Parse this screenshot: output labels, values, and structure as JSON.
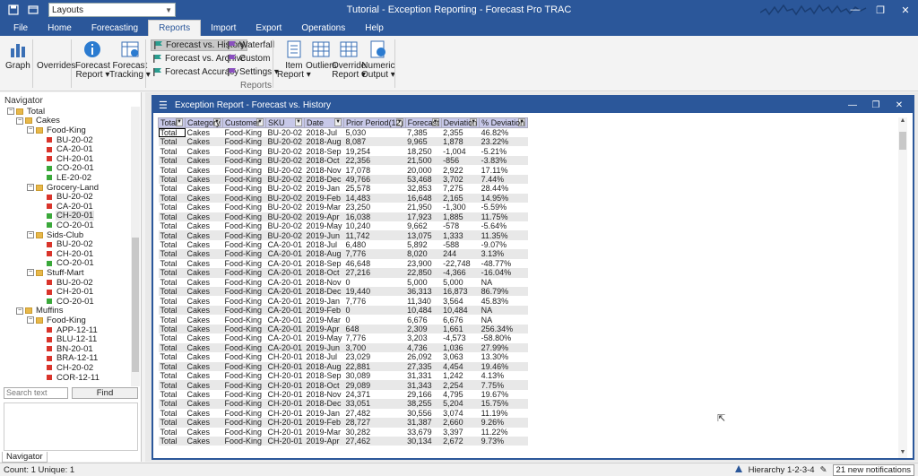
{
  "app": {
    "title": "Tutorial - Exception Reporting - Forecast Pro TRAC",
    "layout_combo": "Layouts"
  },
  "ribbon": {
    "tabs": [
      "File",
      "Home",
      "Forecasting",
      "Reports",
      "Import",
      "Export",
      "Operations",
      "Help"
    ],
    "active_tab": "Reports",
    "buttons": {
      "graph": "Graph",
      "overrides": "Overrides",
      "forecast_report_1": "Forecast",
      "forecast_report_2": "Report",
      "forecast_tracking_1": "Forecast",
      "forecast_tracking_2": "Tracking",
      "item_report_1": "Item",
      "item_report_2": "Report",
      "outliers": "Outliers",
      "override_report_1": "Override",
      "override_report_2": "Report",
      "numeric_output_1": "Numeric",
      "numeric_output_2": "Output"
    },
    "small": {
      "fvh": "Forecast vs. History",
      "fva": "Forecast vs. Archive",
      "fa": "Forecast Accuracy",
      "waterfall": "Waterfall",
      "custom": "Custom",
      "settings": "Settings"
    },
    "group_label": "Reports"
  },
  "navigator": {
    "title": "Navigator",
    "search_placeholder": "Search text",
    "find_label": "Find",
    "tab_label": "Navigator",
    "tree": [
      {
        "label": "Total",
        "level": 0,
        "kind": "folder"
      },
      {
        "label": "Cakes",
        "level": 1,
        "kind": "folder"
      },
      {
        "label": "Food-King",
        "level": 2,
        "kind": "folder"
      },
      {
        "label": "BU-20-02",
        "level": 3,
        "kind": "red"
      },
      {
        "label": "CA-20-01",
        "level": 3,
        "kind": "red"
      },
      {
        "label": "CH-20-01",
        "level": 3,
        "kind": "red"
      },
      {
        "label": "CO-20-01",
        "level": 3,
        "kind": "green"
      },
      {
        "label": "LE-20-02",
        "level": 3,
        "kind": "green"
      },
      {
        "label": "Grocery-Land",
        "level": 2,
        "kind": "folder"
      },
      {
        "label": "BU-20-02",
        "level": 3,
        "kind": "red"
      },
      {
        "label": "CA-20-01",
        "level": 3,
        "kind": "red"
      },
      {
        "label": "CH-20-01",
        "level": 3,
        "kind": "green",
        "highlight": true
      },
      {
        "label": "CO-20-01",
        "level": 3,
        "kind": "green"
      },
      {
        "label": "Sids-Club",
        "level": 2,
        "kind": "folder"
      },
      {
        "label": "BU-20-02",
        "level": 3,
        "kind": "red"
      },
      {
        "label": "CH-20-01",
        "level": 3,
        "kind": "red"
      },
      {
        "label": "CO-20-01",
        "level": 3,
        "kind": "green"
      },
      {
        "label": "Stuff-Mart",
        "level": 2,
        "kind": "folder"
      },
      {
        "label": "BU-20-02",
        "level": 3,
        "kind": "red"
      },
      {
        "label": "CH-20-01",
        "level": 3,
        "kind": "red"
      },
      {
        "label": "CO-20-01",
        "level": 3,
        "kind": "green"
      },
      {
        "label": "Muffins",
        "level": 1,
        "kind": "folder"
      },
      {
        "label": "Food-King",
        "level": 2,
        "kind": "folder"
      },
      {
        "label": "APP-12-11",
        "level": 3,
        "kind": "red"
      },
      {
        "label": "BLU-12-11",
        "level": 3,
        "kind": "red"
      },
      {
        "label": "BN-20-01",
        "level": 3,
        "kind": "red"
      },
      {
        "label": "BRA-12-11",
        "level": 3,
        "kind": "red"
      },
      {
        "label": "CH-20-02",
        "level": 3,
        "kind": "red"
      },
      {
        "label": "COR-12-11",
        "level": 3,
        "kind": "red"
      }
    ]
  },
  "report": {
    "window_title": "Exception Report - Forecast vs. History",
    "columns": [
      "Total",
      "Category",
      "Customer",
      "SKU",
      "Date",
      "Prior Period(12)",
      "Forecast",
      "Deviation",
      "% Deviation"
    ],
    "rows": [
      [
        "Total",
        "Cakes",
        "Food-King",
        "BU-20-02",
        "2018-Jul",
        "5,030",
        "7,385",
        "2,355",
        "46.82%"
      ],
      [
        "Total",
        "Cakes",
        "Food-King",
        "BU-20-02",
        "2018-Aug",
        "8,087",
        "9,965",
        "1,878",
        "23.22%"
      ],
      [
        "Total",
        "Cakes",
        "Food-King",
        "BU-20-02",
        "2018-Sep",
        "19,254",
        "18,250",
        "-1,004",
        "-5.21%"
      ],
      [
        "Total",
        "Cakes",
        "Food-King",
        "BU-20-02",
        "2018-Oct",
        "22,356",
        "21,500",
        "-856",
        "-3.83%"
      ],
      [
        "Total",
        "Cakes",
        "Food-King",
        "BU-20-02",
        "2018-Nov",
        "17,078",
        "20,000",
        "2,922",
        "17.11%"
      ],
      [
        "Total",
        "Cakes",
        "Food-King",
        "BU-20-02",
        "2018-Dec",
        "49,766",
        "53,468",
        "3,702",
        "7.44%"
      ],
      [
        "Total",
        "Cakes",
        "Food-King",
        "BU-20-02",
        "2019-Jan",
        "25,578",
        "32,853",
        "7,275",
        "28.44%"
      ],
      [
        "Total",
        "Cakes",
        "Food-King",
        "BU-20-02",
        "2019-Feb",
        "14,483",
        "16,648",
        "2,165",
        "14.95%"
      ],
      [
        "Total",
        "Cakes",
        "Food-King",
        "BU-20-02",
        "2019-Mar",
        "23,250",
        "21,950",
        "-1,300",
        "-5.59%"
      ],
      [
        "Total",
        "Cakes",
        "Food-King",
        "BU-20-02",
        "2019-Apr",
        "16,038",
        "17,923",
        "1,885",
        "11.75%"
      ],
      [
        "Total",
        "Cakes",
        "Food-King",
        "BU-20-02",
        "2019-May",
        "10,240",
        "9,662",
        "-578",
        "-5.64%"
      ],
      [
        "Total",
        "Cakes",
        "Food-King",
        "BU-20-02",
        "2019-Jun",
        "11,742",
        "13,075",
        "1,333",
        "11.35%"
      ],
      [
        "Total",
        "Cakes",
        "Food-King",
        "CA-20-01",
        "2018-Jul",
        "6,480",
        "5,892",
        "-588",
        "-9.07%"
      ],
      [
        "Total",
        "Cakes",
        "Food-King",
        "CA-20-01",
        "2018-Aug",
        "7,776",
        "8,020",
        "244",
        "3.13%"
      ],
      [
        "Total",
        "Cakes",
        "Food-King",
        "CA-20-01",
        "2018-Sep",
        "46,648",
        "23,900",
        "-22,748",
        "-48.77%"
      ],
      [
        "Total",
        "Cakes",
        "Food-King",
        "CA-20-01",
        "2018-Oct",
        "27,216",
        "22,850",
        "-4,366",
        "-16.04%"
      ],
      [
        "Total",
        "Cakes",
        "Food-King",
        "CA-20-01",
        "2018-Nov",
        "0",
        "5,000",
        "5,000",
        "NA"
      ],
      [
        "Total",
        "Cakes",
        "Food-King",
        "CA-20-01",
        "2018-Dec",
        "19,440",
        "36,313",
        "16,873",
        "86.79%"
      ],
      [
        "Total",
        "Cakes",
        "Food-King",
        "CA-20-01",
        "2019-Jan",
        "7,776",
        "11,340",
        "3,564",
        "45.83%"
      ],
      [
        "Total",
        "Cakes",
        "Food-King",
        "CA-20-01",
        "2019-Feb",
        "0",
        "10,484",
        "10,484",
        "NA"
      ],
      [
        "Total",
        "Cakes",
        "Food-King",
        "CA-20-01",
        "2019-Mar",
        "0",
        "6,676",
        "6,676",
        "NA"
      ],
      [
        "Total",
        "Cakes",
        "Food-King",
        "CA-20-01",
        "2019-Apr",
        "648",
        "2,309",
        "1,661",
        "256.34%"
      ],
      [
        "Total",
        "Cakes",
        "Food-King",
        "CA-20-01",
        "2019-May",
        "7,776",
        "3,203",
        "-4,573",
        "-58.80%"
      ],
      [
        "Total",
        "Cakes",
        "Food-King",
        "CA-20-01",
        "2019-Jun",
        "3,700",
        "4,736",
        "1,036",
        "27.99%"
      ],
      [
        "Total",
        "Cakes",
        "Food-King",
        "CH-20-01",
        "2018-Jul",
        "23,029",
        "26,092",
        "3,063",
        "13.30%"
      ],
      [
        "Total",
        "Cakes",
        "Food-King",
        "CH-20-01",
        "2018-Aug",
        "22,881",
        "27,335",
        "4,454",
        "19.46%"
      ],
      [
        "Total",
        "Cakes",
        "Food-King",
        "CH-20-01",
        "2018-Sep",
        "30,089",
        "31,331",
        "1,242",
        "4.13%"
      ],
      [
        "Total",
        "Cakes",
        "Food-King",
        "CH-20-01",
        "2018-Oct",
        "29,089",
        "31,343",
        "2,254",
        "7.75%"
      ],
      [
        "Total",
        "Cakes",
        "Food-King",
        "CH-20-01",
        "2018-Nov",
        "24,371",
        "29,166",
        "4,795",
        "19.67%"
      ],
      [
        "Total",
        "Cakes",
        "Food-King",
        "CH-20-01",
        "2018-Dec",
        "33,051",
        "38,255",
        "5,204",
        "15.75%"
      ],
      [
        "Total",
        "Cakes",
        "Food-King",
        "CH-20-01",
        "2019-Jan",
        "27,482",
        "30,556",
        "3,074",
        "11.19%"
      ],
      [
        "Total",
        "Cakes",
        "Food-King",
        "CH-20-01",
        "2019-Feb",
        "28,727",
        "31,387",
        "2,660",
        "9.26%"
      ],
      [
        "Total",
        "Cakes",
        "Food-King",
        "CH-20-01",
        "2019-Mar",
        "30,282",
        "33,679",
        "3,397",
        "11.22%"
      ],
      [
        "Total",
        "Cakes",
        "Food-King",
        "CH-20-01",
        "2019-Apr",
        "27,462",
        "30,134",
        "2,672",
        "9.73%"
      ]
    ]
  },
  "status": {
    "left": "Count: 1  Unique: 1",
    "hierarchy": "Hierarchy 1-2-3-4",
    "notifications": "21 new notifications"
  },
  "colors": {
    "brand": "#2b579a",
    "header_bg": "#c7c8e8",
    "red_item": "#d9342b",
    "green_item": "#3aa83a"
  }
}
